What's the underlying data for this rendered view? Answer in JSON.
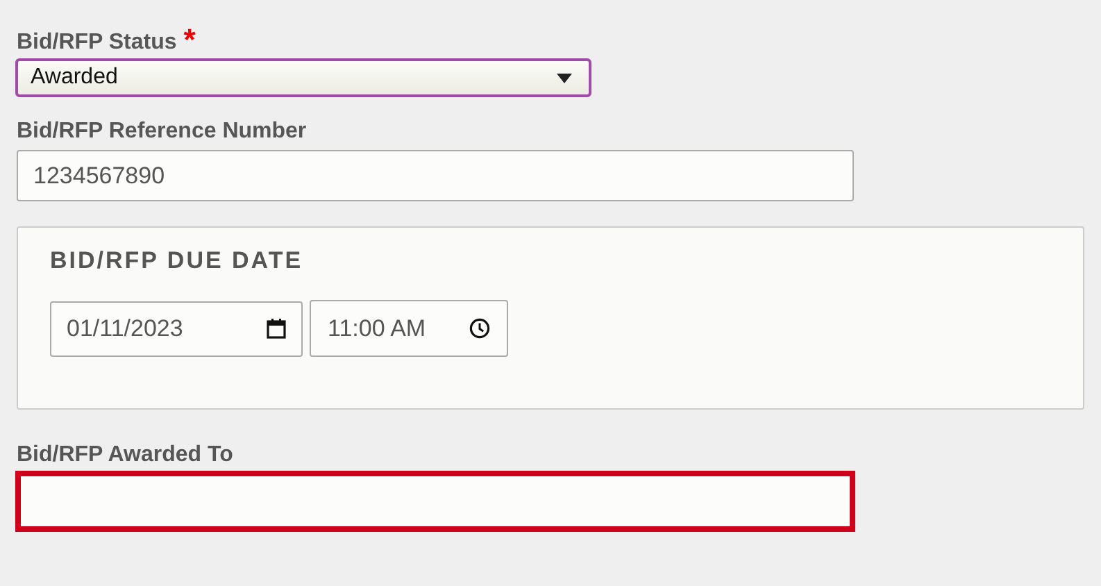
{
  "status": {
    "label": "Bid/RFP Status",
    "required_mark": "*",
    "value": "Awarded",
    "focused": true
  },
  "reference": {
    "label": "Bid/RFP Reference Number",
    "value": "1234567890"
  },
  "due_date": {
    "legend": "BID/RFP DUE DATE",
    "date": "01/11/2023",
    "time": "11:00 AM"
  },
  "awarded_to": {
    "label": "Bid/RFP Awarded To",
    "invalid": true
  }
}
